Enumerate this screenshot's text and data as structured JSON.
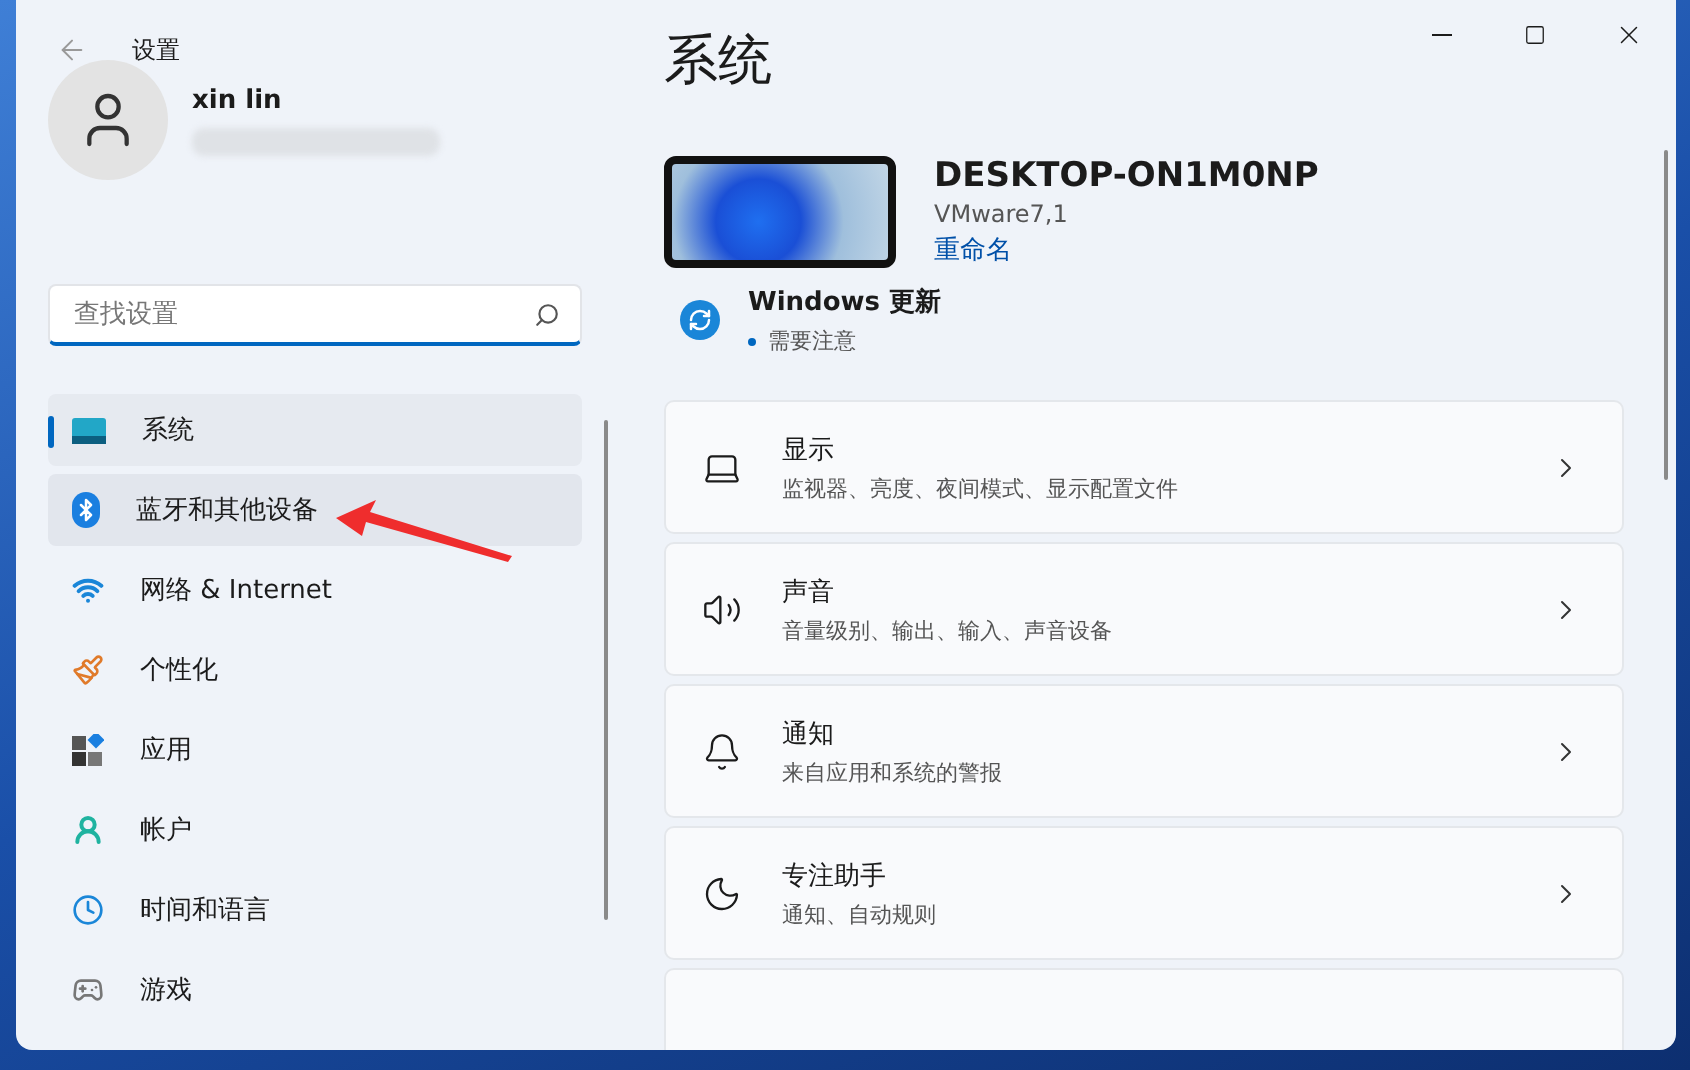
{
  "window": {
    "title": "设置"
  },
  "user": {
    "name": "xin lin"
  },
  "search": {
    "placeholder": "查找设置"
  },
  "sidebar": {
    "items": [
      {
        "label": "系统",
        "selected": true,
        "hovered": false
      },
      {
        "label": "蓝牙和其他设备",
        "selected": false,
        "hovered": true
      },
      {
        "label": "网络 & Internet",
        "selected": false,
        "hovered": false
      },
      {
        "label": "个性化",
        "selected": false,
        "hovered": false
      },
      {
        "label": "应用",
        "selected": false,
        "hovered": false
      },
      {
        "label": "帐户",
        "selected": false,
        "hovered": false
      },
      {
        "label": "时间和语言",
        "selected": false,
        "hovered": false
      },
      {
        "label": "游戏",
        "selected": false,
        "hovered": false
      }
    ]
  },
  "page": {
    "title": "系统"
  },
  "device": {
    "name": "DESKTOP-ON1M0NP",
    "model": "VMware7,1",
    "rename_link": "重命名"
  },
  "update": {
    "title": "Windows 更新",
    "status": "需要注意"
  },
  "settings": [
    {
      "title": "显示",
      "subtitle": "监视器、亮度、夜间模式、显示配置文件"
    },
    {
      "title": "声音",
      "subtitle": "音量级别、输出、输入、声音设备"
    },
    {
      "title": "通知",
      "subtitle": "来自应用和系统的警报"
    },
    {
      "title": "专注助手",
      "subtitle": "通知、自动规则"
    }
  ]
}
